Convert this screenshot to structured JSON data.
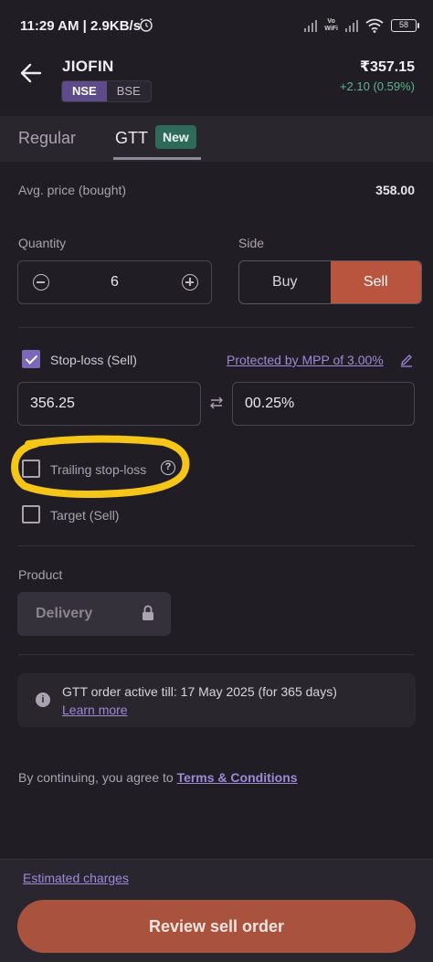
{
  "status_bar": {
    "time": "11:29 AM | 2.9KB/s",
    "vowifi_top": "Vo",
    "vowifi_bottom": "WiFi",
    "battery": "58"
  },
  "header": {
    "symbol": "JIOFIN",
    "exchanges": [
      "NSE",
      "BSE"
    ],
    "selected_exchange": "NSE",
    "price": "₹357.15",
    "change": "+2.10 (0.59%)"
  },
  "tabs": {
    "regular": "Regular",
    "gtt": "GTT",
    "new_badge": "New"
  },
  "avg_price": {
    "label": "Avg. price (bought)",
    "value": "358.00"
  },
  "quantity": {
    "label": "Quantity",
    "value": "6"
  },
  "side": {
    "label": "Side",
    "buy": "Buy",
    "sell": "Sell",
    "selected": "Sell"
  },
  "stoploss": {
    "label": "Stop-loss (Sell)",
    "checked": true,
    "mpp_link": "Protected by MPP of 3.00%",
    "price": "356.25",
    "percent": "00.25%"
  },
  "trailing": {
    "label": "Trailing stop-loss",
    "checked": false
  },
  "target": {
    "label": "Target (Sell)",
    "checked": false
  },
  "product": {
    "label": "Product",
    "value": "Delivery"
  },
  "info": {
    "text": "GTT order active till: 17 May 2025 (for 365 days)",
    "link": "Learn more"
  },
  "agreement": {
    "prefix": "By continuing, you agree to ",
    "link": "Terms & Conditions"
  },
  "footer": {
    "charges_link": "Estimated charges",
    "button": "Review sell order"
  },
  "colors": {
    "background": "#201d24",
    "accent_purple": "#7b68b8",
    "sell": "#b9553f",
    "positive": "#5fb58a",
    "highlight": "#f5c518"
  }
}
